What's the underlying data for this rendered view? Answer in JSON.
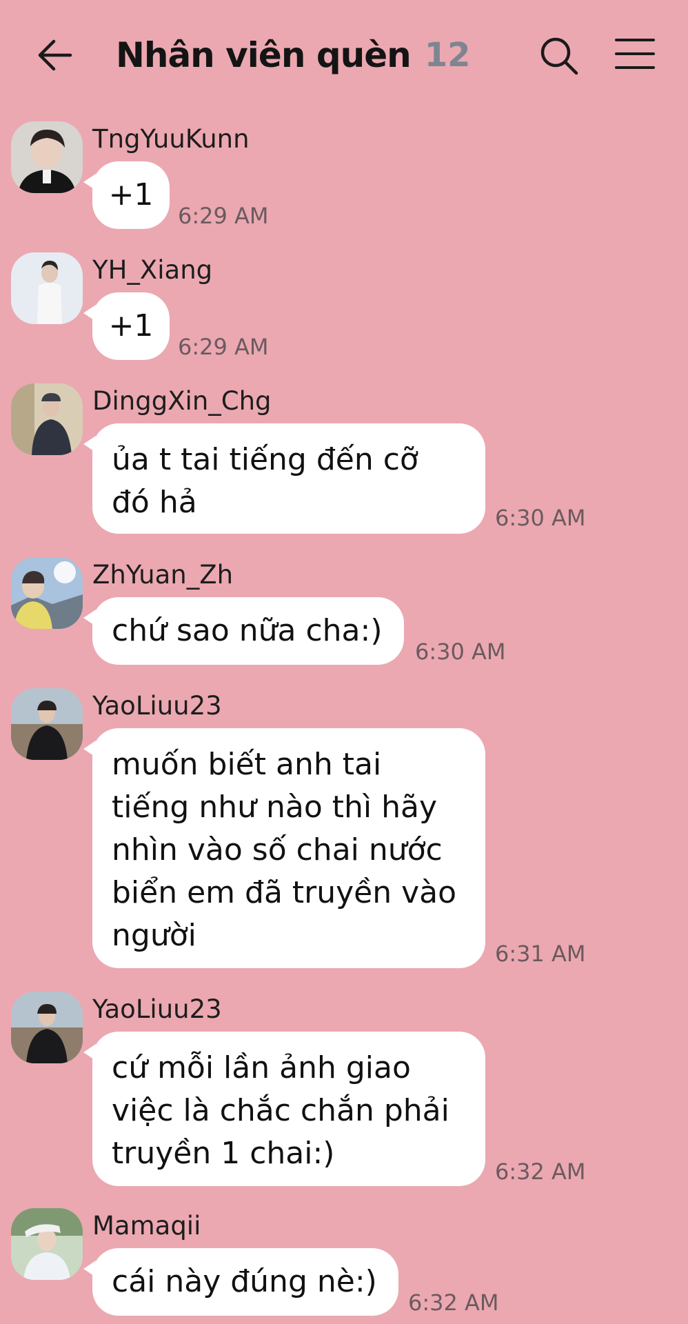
{
  "header": {
    "title": "Nhân viên quèn",
    "member_count": "12",
    "back_icon": "arrow-left-icon",
    "search_icon": "search-icon",
    "menu_icon": "hamburger-menu-icon"
  },
  "messages": [
    {
      "sender": "TngYuuKunn",
      "text": "+1",
      "time": "6:29 AM"
    },
    {
      "sender": "YH_Xiang",
      "text": "+1",
      "time": "6:29 AM"
    },
    {
      "sender": "DinggXin_Chg",
      "lines": [
        "ủa t tai tiếng đến cỡ",
        "đó hả"
      ],
      "time": "6:30 AM"
    },
    {
      "sender": "ZhYuan_Zh",
      "text": "chứ sao nữa cha:)",
      "time": "6:30 AM"
    },
    {
      "sender": "YaoLiuu23",
      "lines": [
        "muốn biết anh tai",
        "tiếng như nào thì hãy",
        "nhìn vào số chai nước",
        "biển em đã truyền vào",
        "người"
      ],
      "time": "6:31 AM"
    },
    {
      "sender": "YaoLiuu23",
      "lines": [
        "cứ mỗi lần ảnh giao",
        "việc là chắc chắn phải",
        "truyền 1 chai:)"
      ],
      "time": "6:32 AM"
    },
    {
      "sender": "Mamaqii",
      "text": "cái này đúng nè:)",
      "time": "6:32 AM"
    }
  ]
}
